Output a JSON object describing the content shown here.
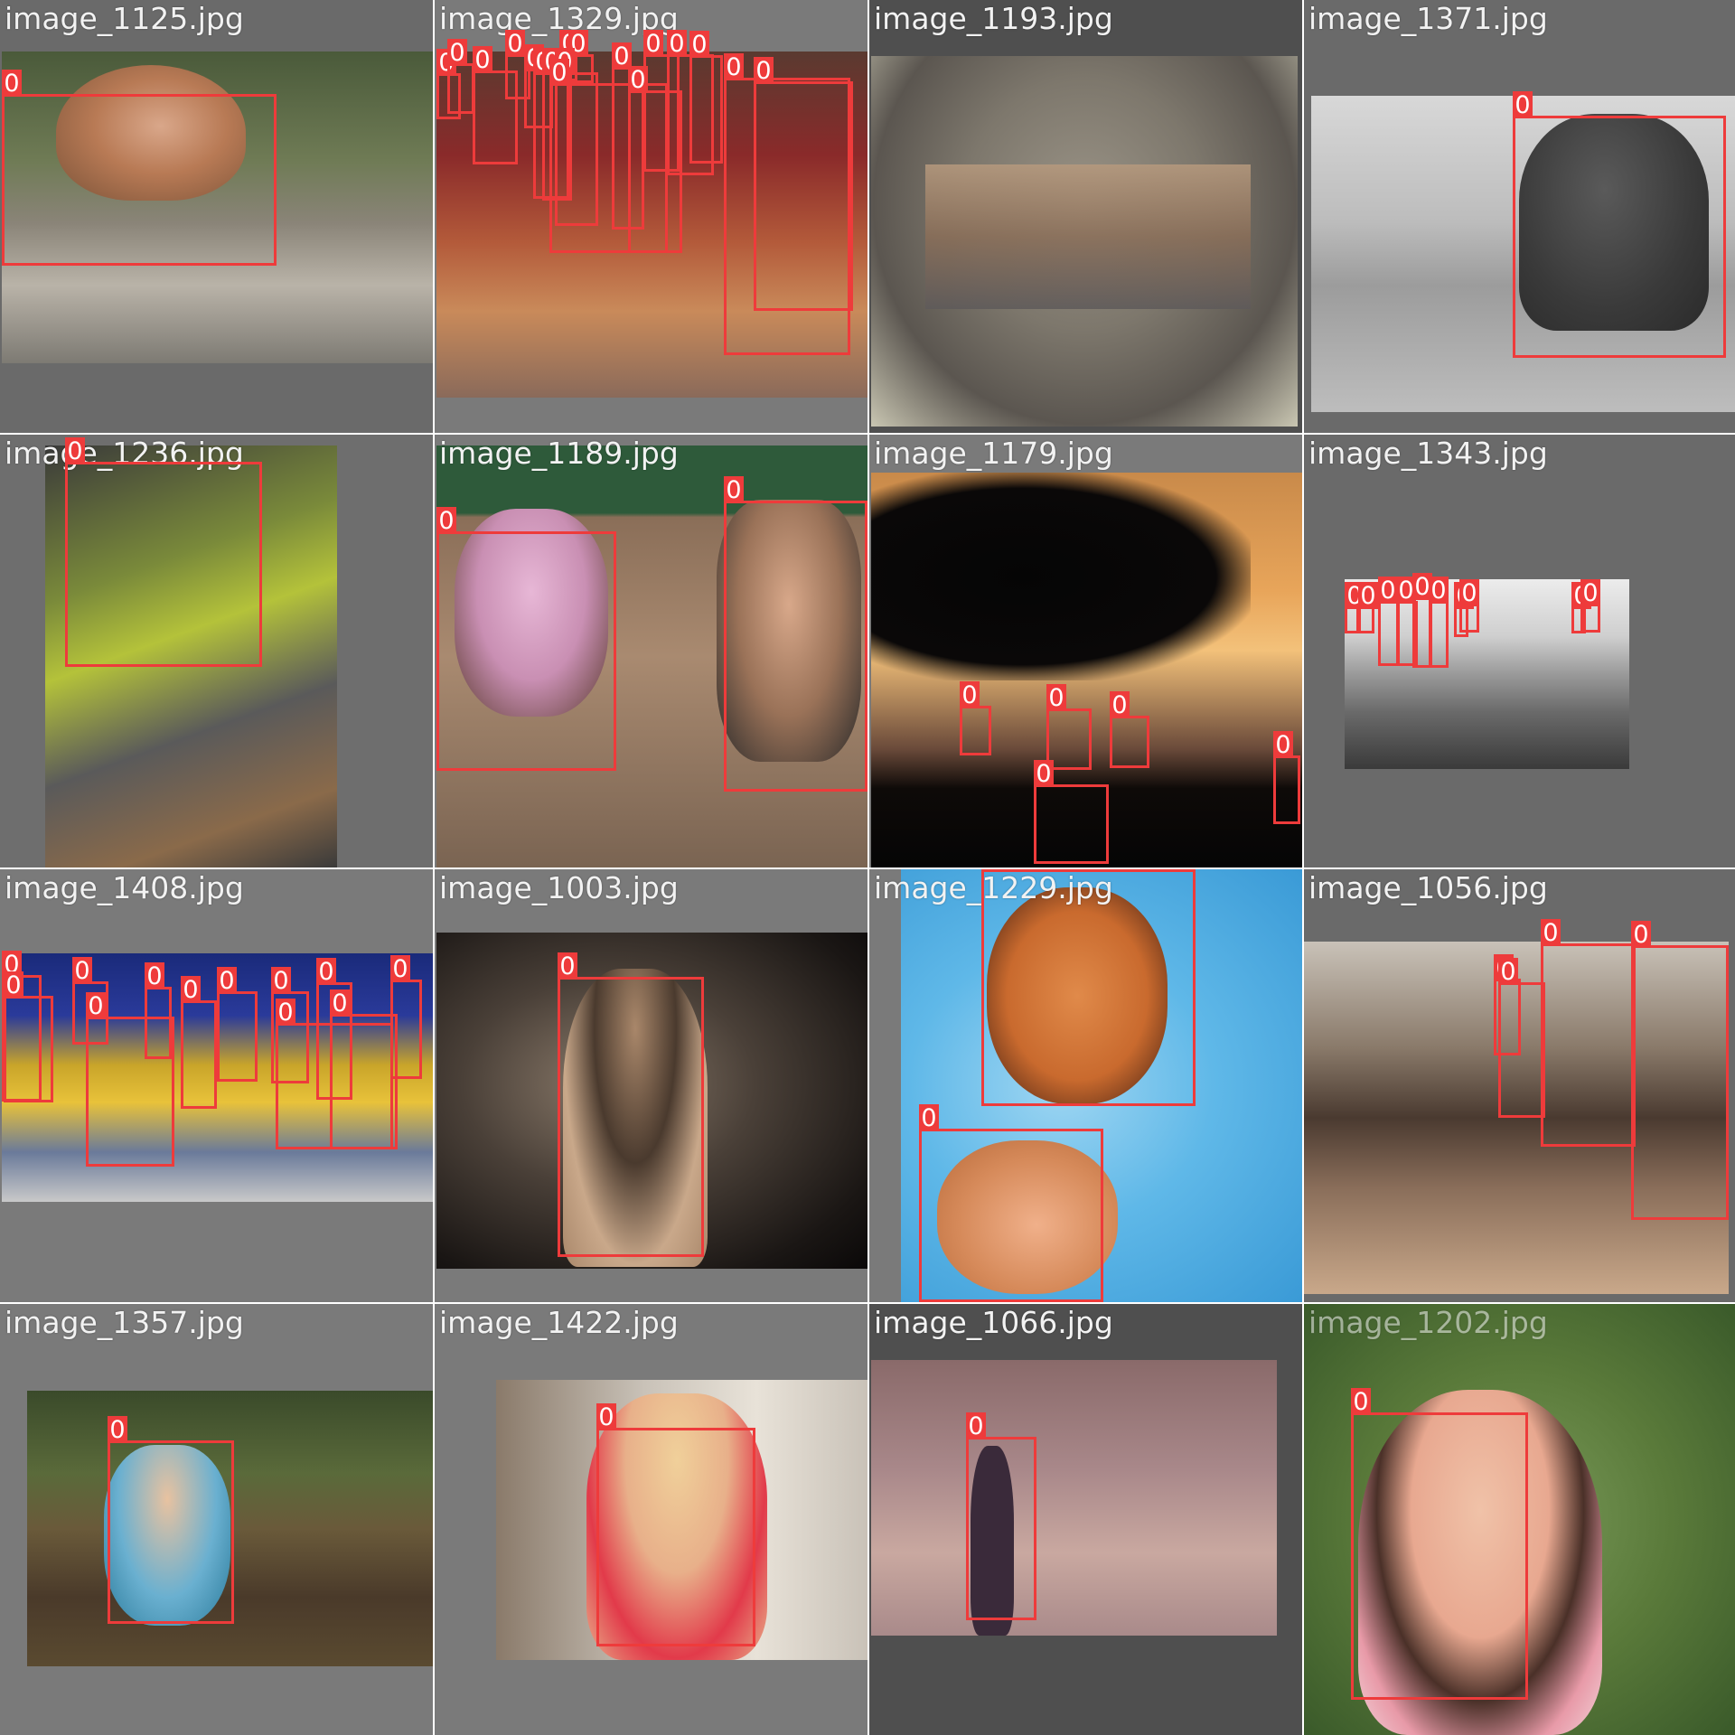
{
  "colors": {
    "box": "#ee3b3b",
    "label_text": "#ffffff",
    "filename_text": "#f2f2f2",
    "tile_background": "#6e6e6e"
  },
  "tiles": [
    {
      "filename": "image_1125.jpg",
      "scene": "woman-on-bench",
      "detections": [
        "0"
      ]
    },
    {
      "filename": "image_1329.jpg",
      "scene": "market-crowd",
      "detections": [
        "0",
        "0",
        "0",
        "0",
        "0",
        "0",
        "0",
        "0",
        "0",
        "0",
        "0",
        "0",
        "0",
        "0",
        "0",
        "0",
        "0",
        "0"
      ]
    },
    {
      "filename": "image_1193.jpg",
      "scene": "double-exposure-face",
      "detections": []
    },
    {
      "filename": "image_1371.jpg",
      "scene": "runner-tying-shoe",
      "detections": [
        "0"
      ]
    },
    {
      "filename": "image_1236.jpg",
      "scene": "welder",
      "detections": [
        "0"
      ]
    },
    {
      "filename": "image_1189.jpg",
      "scene": "kids-on-dock",
      "detections": [
        "0",
        "0"
      ]
    },
    {
      "filename": "image_1179.jpg",
      "scene": "sunset-silhouettes",
      "detections": [
        "0",
        "0",
        "0",
        "0",
        "0"
      ]
    },
    {
      "filename": "image_1343.jpg",
      "scene": "beach-walkers",
      "detections": [
        "0",
        "0",
        "0",
        "0",
        "0",
        "0",
        "0",
        "0",
        "0",
        "0"
      ]
    },
    {
      "filename": "image_1408.jpg",
      "scene": "folk-dancers",
      "detections": [
        "0",
        "0",
        "0",
        "0",
        "0",
        "0",
        "0",
        "0",
        "0",
        "0",
        "0",
        "0"
      ]
    },
    {
      "filename": "image_1003.jpg",
      "scene": "girl-portrait",
      "detections": [
        "0"
      ]
    },
    {
      "filename": "image_1229.jpg",
      "scene": "kids-in-pool",
      "detections": [
        "0",
        "0"
      ]
    },
    {
      "filename": "image_1056.jpg",
      "scene": "cafe-legs",
      "detections": [
        "0",
        "0",
        "0",
        "0"
      ]
    },
    {
      "filename": "image_1357.jpg",
      "scene": "girl-in-garden",
      "detections": [
        "0"
      ]
    },
    {
      "filename": "image_1422.jpg",
      "scene": "woman-with-dumbbells",
      "detections": [
        "0"
      ]
    },
    {
      "filename": "image_1066.jpg",
      "scene": "woman-silhouette-sky",
      "detections": [
        "0"
      ]
    },
    {
      "filename": "image_1202.jpg",
      "scene": "woman-with-disguise",
      "detections": [
        "0"
      ]
    }
  ]
}
